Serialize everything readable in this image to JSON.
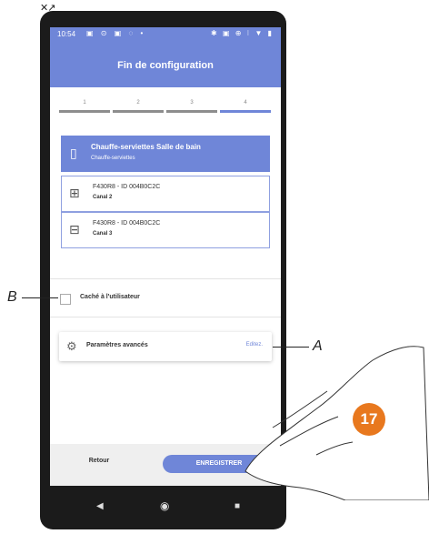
{
  "status_bar": {
    "time": "10:54",
    "left_icons": "▣ ⊙ ▣ ◌ •",
    "right_icons": "✱ ▣ ⊕ ⁝ ▼ ▮"
  },
  "header": {
    "title": "Fin de configuration"
  },
  "steps": [
    {
      "label": "1",
      "active": false
    },
    {
      "label": "2",
      "active": false
    },
    {
      "label": "3",
      "active": false
    },
    {
      "label": "4",
      "active": true
    }
  ],
  "object": {
    "name": "Chauffe-serviettes Salle de bain",
    "type": "Chauffe-serviettes",
    "icon": "towel-heater-icon"
  },
  "devices": [
    {
      "id": "F430R8 - ID 004B0C2C",
      "channel": "Canal 2",
      "icon": "network-icon"
    },
    {
      "id": "F430R8 - ID 004B0C2C",
      "channel": "Canal 3",
      "icon": "actuator-icon"
    }
  ],
  "hidden_option": {
    "label": "Caché à l'utilisateur",
    "checked": false
  },
  "advanced": {
    "label": "Paramètres avancés",
    "edit_label": "Editez."
  },
  "footer": {
    "back_label": "Retour",
    "save_label": "ENREGISTRER"
  },
  "callouts": {
    "a": "A",
    "b": "B"
  },
  "step_badge": "17",
  "colors": {
    "accent": "#6f86d8",
    "badge": "#e8781e"
  }
}
